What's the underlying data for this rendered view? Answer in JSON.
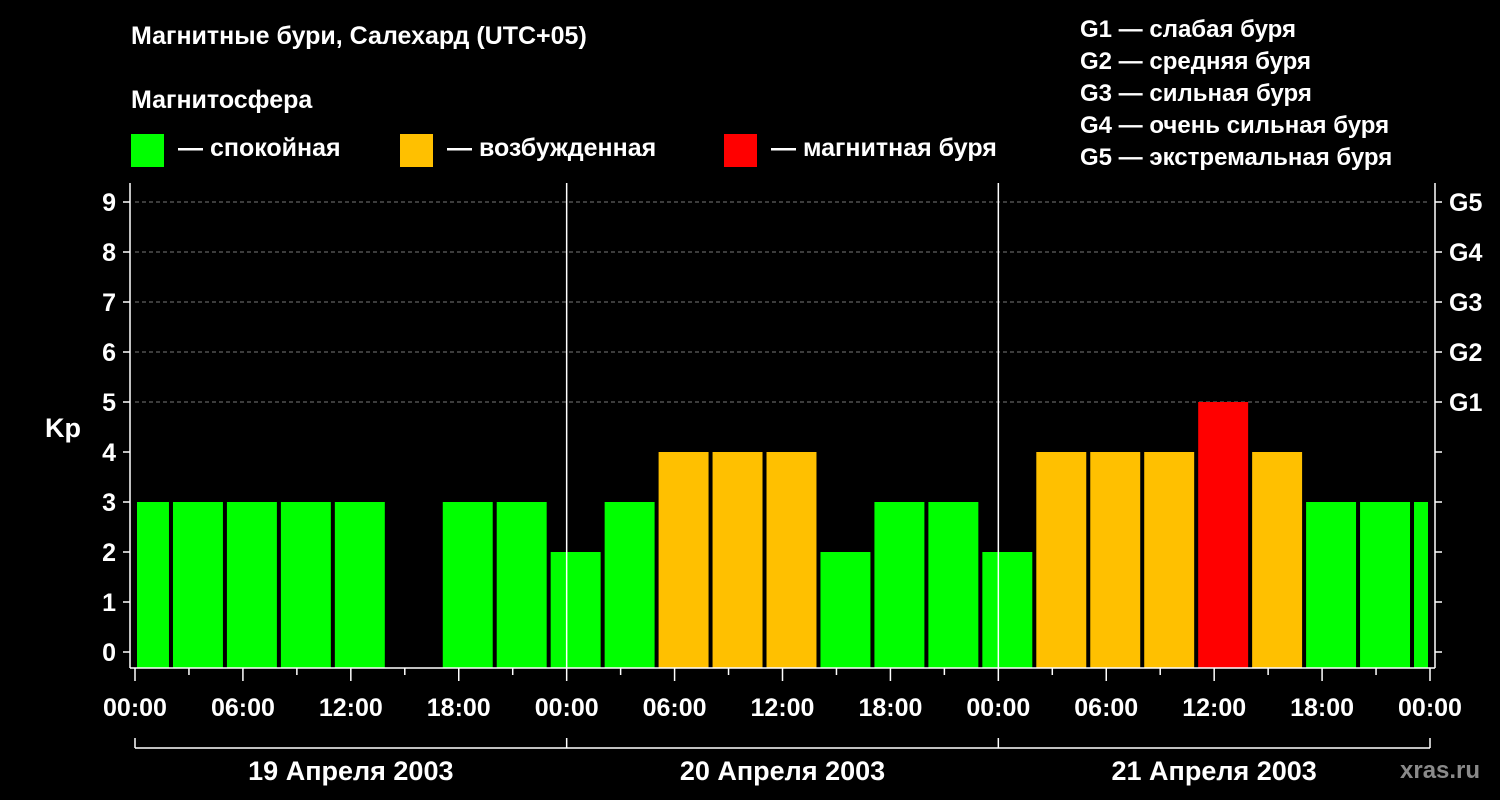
{
  "title": "Магнитные бури, Салехард (UTC+05)",
  "legend": {
    "title": "Магнитосфера",
    "items": [
      {
        "label": "— спокойная",
        "color": "#00ff00"
      },
      {
        "label": "— возбужденная",
        "color": "#ffc000"
      },
      {
        "label": "— магнитная буря",
        "color": "#ff0000"
      }
    ]
  },
  "g_scale": [
    "G1 — слабая буря",
    "G2 — средняя буря",
    "G3 — сильная буря",
    "G4 — очень сильная буря",
    "G5 — экстремальная буря"
  ],
  "watermark": "xras.ru",
  "chart_data": {
    "type": "bar",
    "ylabel": "Kp",
    "ylim": [
      0,
      9
    ],
    "y_ticks": [
      0,
      1,
      2,
      3,
      4,
      5,
      6,
      7,
      8,
      9
    ],
    "right_axis_labels": [
      {
        "kp": 5,
        "label": "G1"
      },
      {
        "kp": 6,
        "label": "G2"
      },
      {
        "kp": 7,
        "label": "G3"
      },
      {
        "kp": 8,
        "label": "G4"
      },
      {
        "kp": 9,
        "label": "G5"
      }
    ],
    "x_range_hours": [
      0,
      72
    ],
    "x_tick_labels": [
      "00:00",
      "06:00",
      "12:00",
      "18:00",
      "00:00",
      "06:00",
      "12:00",
      "18:00",
      "00:00",
      "06:00",
      "12:00",
      "18:00",
      "00:00"
    ],
    "days": [
      "19 Апреля 2003",
      "20 Апреля 2003",
      "21 Апреля 2003"
    ],
    "grid": "horizontal dashed",
    "bars": [
      {
        "start": 0,
        "end": 2,
        "kp": 3,
        "color": "#00ff00"
      },
      {
        "start": 2,
        "end": 5,
        "kp": 3,
        "color": "#00ff00"
      },
      {
        "start": 5,
        "end": 8,
        "kp": 3,
        "color": "#00ff00"
      },
      {
        "start": 8,
        "end": 11,
        "kp": 3,
        "color": "#00ff00"
      },
      {
        "start": 11,
        "end": 14,
        "kp": 3,
        "color": "#00ff00"
      },
      {
        "start": 17,
        "end": 20,
        "kp": 3,
        "color": "#00ff00"
      },
      {
        "start": 20,
        "end": 23,
        "kp": 3,
        "color": "#00ff00"
      },
      {
        "start": 23,
        "end": 26,
        "kp": 2,
        "color": "#00ff00"
      },
      {
        "start": 26,
        "end": 29,
        "kp": 3,
        "color": "#00ff00"
      },
      {
        "start": 29,
        "end": 32,
        "kp": 4,
        "color": "#ffc000"
      },
      {
        "start": 32,
        "end": 35,
        "kp": 4,
        "color": "#ffc000"
      },
      {
        "start": 35,
        "end": 38,
        "kp": 4,
        "color": "#ffc000"
      },
      {
        "start": 38,
        "end": 41,
        "kp": 2,
        "color": "#00ff00"
      },
      {
        "start": 41,
        "end": 44,
        "kp": 3,
        "color": "#00ff00"
      },
      {
        "start": 44,
        "end": 47,
        "kp": 3,
        "color": "#00ff00"
      },
      {
        "start": 47,
        "end": 50,
        "kp": 2,
        "color": "#00ff00"
      },
      {
        "start": 50,
        "end": 53,
        "kp": 4,
        "color": "#ffc000"
      },
      {
        "start": 53,
        "end": 56,
        "kp": 4,
        "color": "#ffc000"
      },
      {
        "start": 56,
        "end": 59,
        "kp": 4,
        "color": "#ffc000"
      },
      {
        "start": 59,
        "end": 62,
        "kp": 5,
        "color": "#ff0000"
      },
      {
        "start": 62,
        "end": 65,
        "kp": 4,
        "color": "#ffc000"
      },
      {
        "start": 65,
        "end": 68,
        "kp": 3,
        "color": "#00ff00"
      },
      {
        "start": 68,
        "end": 71,
        "kp": 3,
        "color": "#00ff00"
      },
      {
        "start": 71,
        "end": 72,
        "kp": 3,
        "color": "#00ff00"
      }
    ]
  }
}
